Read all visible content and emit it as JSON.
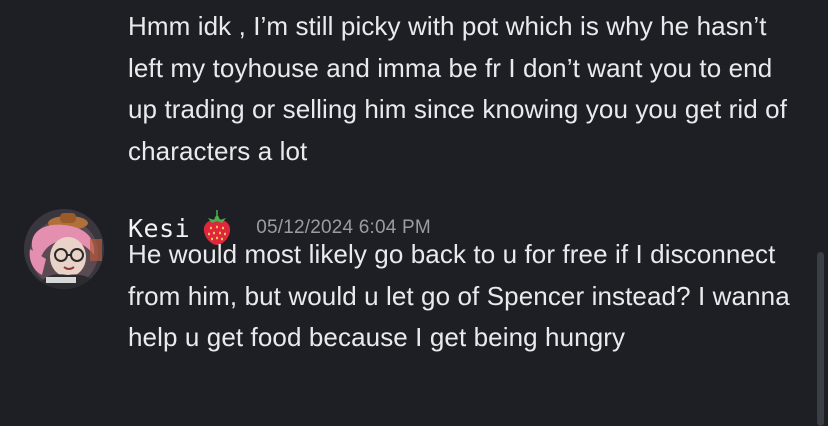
{
  "messages": [
    {
      "continued": true,
      "text": "Hmm idk , I’m still picky with pot which is why he hasn’t left my toyhouse and imma be fr I don’t want you to end up trading or selling him since knowing you you get rid of characters a lot"
    },
    {
      "author": "Kesi",
      "role_icon": "strawberry-icon",
      "timestamp": "05/12/2024 6:04 PM",
      "avatar": "user-avatar",
      "text": "He would most likely go back to u for free if I disconnect from him, but would u let go of Spencer instead? I wanna help u get food because I get being hungry"
    }
  ],
  "colors": {
    "background": "#1e1f24",
    "text": "#e9eaed",
    "timestamp": "#9a9ca3",
    "scrollbar": "#3c3e45"
  }
}
